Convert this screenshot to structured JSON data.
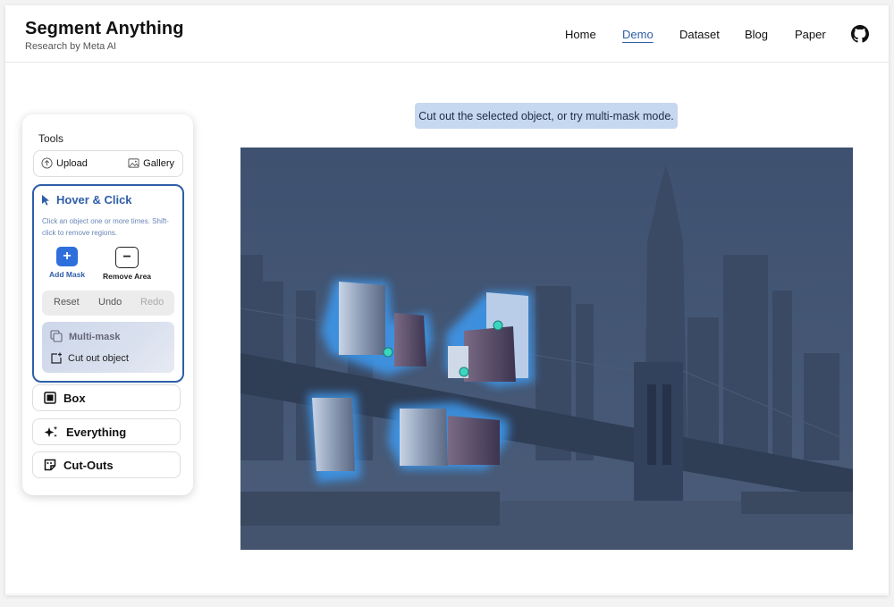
{
  "header": {
    "title": "Segment Anything",
    "subtitle": "Research by Meta AI",
    "nav": [
      {
        "label": "Home",
        "active": false
      },
      {
        "label": "Demo",
        "active": true
      },
      {
        "label": "Dataset",
        "active": false
      },
      {
        "label": "Blog",
        "active": false
      },
      {
        "label": "Paper",
        "active": false
      }
    ],
    "github_icon": "github-icon"
  },
  "tools": {
    "label": "Tools",
    "upload_label": "Upload",
    "gallery_label": "Gallery",
    "hover_click": {
      "title": "Hover & Click",
      "description": "Click an object one or more times. Shift-click to remove regions.",
      "add_mask_label": "Add Mask",
      "remove_area_label": "Remove Area",
      "reset_label": "Reset",
      "undo_label": "Undo",
      "redo_label": "Redo",
      "multi_mask_label": "Multi-mask",
      "cut_out_label": "Cut out object"
    },
    "box_label": "Box",
    "everything_label": "Everything",
    "cutouts_label": "Cut-Outs"
  },
  "canvas": {
    "hint": "Cut out the selected object, or try multi-mask mode.",
    "accent_color": "#2f5ea8",
    "overlay_color": "#3c5070",
    "mask_glow_color": "#4aa3f0"
  }
}
